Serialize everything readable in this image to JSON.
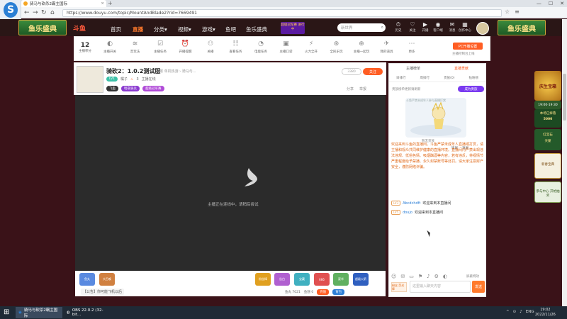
{
  "browser": {
    "tab_title": "骑马与砍杀2霸主国际",
    "tab_close": "×",
    "new_tab": "+",
    "url": "https://www.douyu.com/topic/MountAndBlade2?rid=7669491",
    "nav": {
      "back": "←",
      "forward": "→",
      "refresh": "↻",
      "home": "⌂"
    },
    "window_controls": {
      "min": "—",
      "max": "☐",
      "close": "✕"
    },
    "logo": "S"
  },
  "site": {
    "banner_left": "鱼乐盛典",
    "banner_right": "鱼乐盛典",
    "logo": "斗鱼",
    "nav": [
      "首页",
      "直播",
      "分类▾",
      "视频▾",
      "游戏▾",
      "鱼吧",
      "鱼乐盛典"
    ],
    "promo_text": "超级冠军赛 进行中",
    "search_placeholder": "新世界",
    "search_icon": "⌕",
    "user_menu": [
      {
        "icon": "⏱",
        "label": "历史"
      },
      {
        "icon": "♡",
        "label": "关注"
      },
      {
        "icon": "▶",
        "label": "开播"
      },
      {
        "icon": "◉",
        "label": "客户端"
      },
      {
        "icon": "✉",
        "label": "消息"
      },
      {
        "icon": "▦",
        "label": "创作中心"
      }
    ]
  },
  "toolbar": {
    "level_value": "12",
    "level_label": "主播积分",
    "items": [
      "主播开关",
      "音玩法",
      "主播任务",
      "开播提醒",
      "关播",
      "查看任务",
      "电能任务",
      "主播口袋",
      "火力全开",
      "全民乐玩",
      "主播一起玩",
      "我的道具",
      "更多"
    ],
    "live_setting": "PC开播设置",
    "live_hint": "主播控制台上线"
  },
  "room": {
    "title": "骑砍2：1.0.2测试服",
    "subtitle": "举报  单机热游 › 骑马与...",
    "level_badge": "LV1",
    "owner": "橘子",
    "hot": "3",
    "room_status": "主播在线",
    "tags": [
      "飞鱼",
      "暗夜骑兵",
      "超级冠军赛"
    ],
    "follow_count": "3380",
    "follow_button": "关注",
    "share": "分享",
    "report": "举报",
    "video_message": "主播正在连线中，请稍后尝试",
    "gifts": [
      "鱼丸",
      "大召唤",
      "粉丝棒",
      "告白",
      "宝藏",
      "666",
      "豪华",
      "超级火箭"
    ],
    "bottom_tip": "【公告】你可能飞机以后",
    "fish_balls": "鱼丸 7021",
    "fish_chips": "鱼翅 0",
    "recharge": "充值",
    "backpack": "背包"
  },
  "chat": {
    "tabs_top": [
      "主播榜单",
      "直播贡献"
    ],
    "tabs_second": [
      "日排行",
      "周排行",
      "贵族(0)",
      "钻粉榜"
    ],
    "note": "贵族榜单更新请刷新",
    "invite": "成为贵族",
    "illust_caption": "斗鱼严禁未成年人参与直播打赏",
    "illust_sub": "暂无贵族",
    "options": [
      "锁屏",
      "清屏"
    ],
    "notice": "欢迎来到斗鱼的直播间。斗鱼严禁未成年人直播或打赏，请主播和观众共同维护健康的直播环境。直播间内严禁出现违法违规、低俗色情、吸烟酗酒等内容，若有违反，将视情节严重程度给予禁播、永久封禁账号等处罚。请大家注意财产安全，谨防网络诈骗。",
    "messages": [
      {
        "lv": "LV3",
        "user": "Abcdchdft",
        "text": "欢迎来到本直播间"
      },
      {
        "lv": "LV5",
        "user": "doujo",
        "text": "欢迎来到本直播间"
      }
    ],
    "tool_icons": [
      "☺",
      "✉",
      "▭",
      "⚑",
      "♪",
      "⚙",
      "◐"
    ],
    "lock_label": "屏蔽特效",
    "gift_button": "粉丝 荧光棒",
    "input_placeholder": "这里输入聊天内容",
    "send": "发送"
  },
  "side_promo": {
    "title": "庆生宝箱",
    "time": "19:00-19:30",
    "reward_label": "本场已掉落",
    "reward_value": "5000",
    "item1": "红宝石",
    "item2": "天蒙",
    "item3": "新春宝典",
    "bottom": "参与中心 开始抽奖"
  },
  "taskbar": {
    "start": "⊞",
    "tasks": [
      "骑马与砍杀2霸主国际",
      "OBS 22.0.2 (32-bit..."
    ],
    "tray": [
      "^",
      "⊙",
      "♪",
      "ENG"
    ],
    "time": "19:02",
    "date": "2022/11/26"
  },
  "colors": {
    "accent": "#ff5d23",
    "site_header": "#2a1616",
    "page_bg": "#3a1218",
    "notice": "#e06a1a"
  }
}
